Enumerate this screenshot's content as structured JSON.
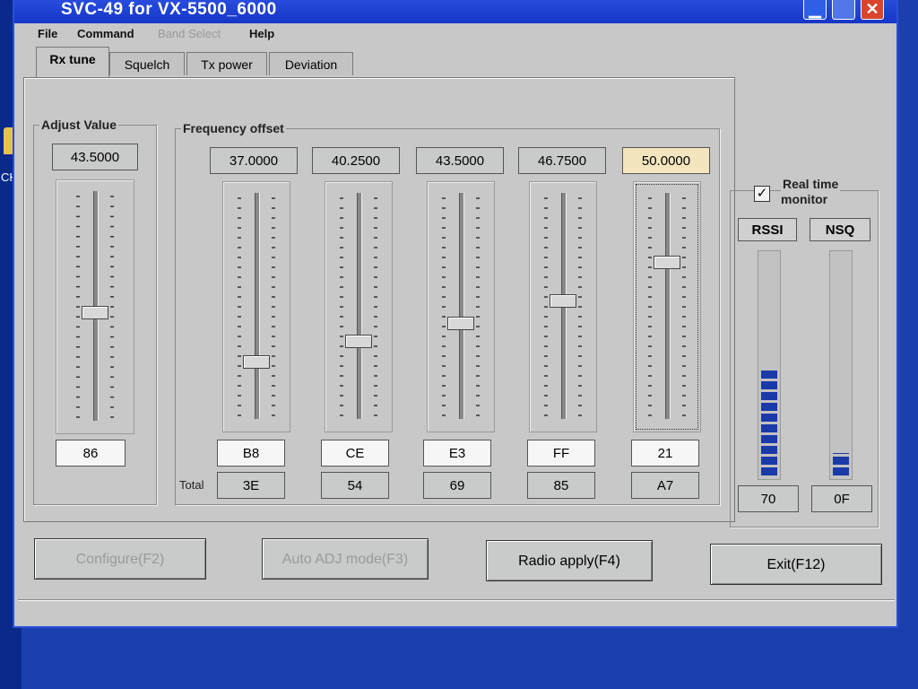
{
  "window": {
    "title": "SVC-49 for VX-5500_6000",
    "minimize_symbol": "▁",
    "maximize_symbol": "",
    "close_symbol": "✕"
  },
  "desktop": {
    "icon_label": "CH"
  },
  "menu": [
    {
      "label": "File",
      "enabled": true
    },
    {
      "label": "Command",
      "enabled": true
    },
    {
      "label": "Band Select",
      "enabled": false
    },
    {
      "label": "Help",
      "enabled": true
    }
  ],
  "tabs": [
    {
      "label": "Rx tune",
      "active": true
    },
    {
      "label": "Squelch",
      "active": false
    },
    {
      "label": "Tx power",
      "active": false
    },
    {
      "label": "Deviation",
      "active": false
    }
  ],
  "adjust_value": {
    "title": "Adjust Value",
    "value": "43.5000",
    "hex": "86",
    "slider_level": 0.47
  },
  "frequency_offset": {
    "title": "Frequency offset",
    "total_label": "Total",
    "channels": [
      {
        "freq": "37.0000",
        "hex": "B8",
        "total": "3E",
        "level": 0.25,
        "selected": false
      },
      {
        "freq": "40.2500",
        "hex": "CE",
        "total": "54",
        "level": 0.34,
        "selected": false
      },
      {
        "freq": "43.5000",
        "hex": "E3",
        "total": "69",
        "level": 0.42,
        "selected": false
      },
      {
        "freq": "46.7500",
        "hex": "FF",
        "total": "85",
        "level": 0.52,
        "selected": false
      },
      {
        "freq": "50.0000",
        "hex": "21",
        "total": "A7",
        "level": 0.69,
        "selected": true
      }
    ]
  },
  "monitor": {
    "checkbox_checked": true,
    "checkbox_mark": "✓",
    "label_line1": "Real time",
    "label_line2": "monitor",
    "meters": [
      {
        "label": "RSSI",
        "value": "70",
        "level": 0.48
      },
      {
        "label": "NSQ",
        "value": "0F",
        "level": 0.1
      }
    ]
  },
  "buttons": [
    {
      "label": "Configure(F2)",
      "enabled": false
    },
    {
      "label": "Auto ADJ mode(F3)",
      "enabled": false
    },
    {
      "label": "Radio apply(F4)",
      "enabled": true
    },
    {
      "label": "Exit(F12)",
      "enabled": true
    }
  ],
  "colors": {
    "title_bar": "#1f45d6",
    "meter_fill": "#1a3aa8",
    "highlight_value": "#f3e6be"
  }
}
